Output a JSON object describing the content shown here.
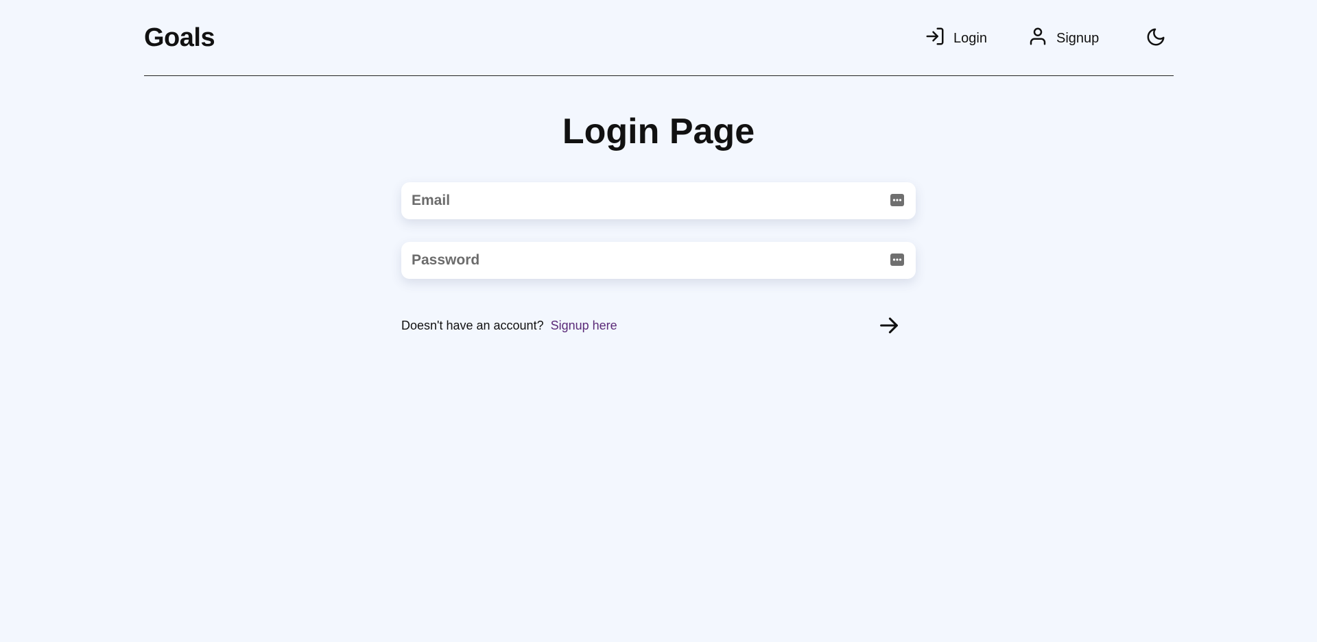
{
  "header": {
    "brand": "Goals",
    "nav": {
      "login_label": "Login",
      "signup_label": "Signup"
    },
    "theme_icon": "moon-icon"
  },
  "main": {
    "title": "Login Page",
    "email": {
      "placeholder": "Email",
      "value": "",
      "icon": "password-manager-icon"
    },
    "password": {
      "placeholder": "Password",
      "value": "",
      "icon": "password-manager-icon"
    },
    "footer": {
      "prompt": "Doesn't have an account?",
      "link_label": "Signup here"
    },
    "submit_icon": "arrow-right-icon"
  },
  "colors": {
    "background": "#f3f7fe",
    "link": "#5a2a78",
    "text": "#111111"
  }
}
